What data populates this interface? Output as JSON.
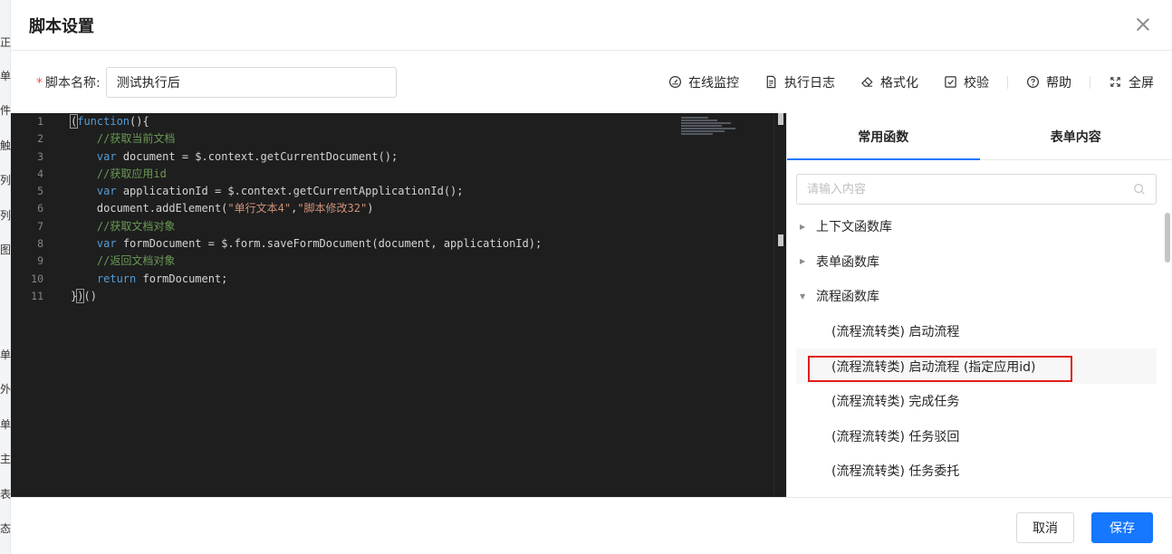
{
  "background_edge": [
    "正",
    "单",
    "件",
    "触",
    "列",
    "列",
    "图",
    "单",
    "外",
    "单",
    "主",
    "表",
    "态"
  ],
  "modal": {
    "title": "脚本设置",
    "close_icon": "close-icon"
  },
  "toolbar": {
    "name_label": "脚本名称:",
    "required_mark": "*",
    "name_value": "测试执行后",
    "actions": [
      {
        "label": "在线监控",
        "icon": "dashboard-icon"
      },
      {
        "label": "执行日志",
        "icon": "file-text-icon"
      },
      {
        "label": "格式化",
        "icon": "eraser-icon"
      },
      {
        "label": "校验",
        "icon": "check-square-icon"
      },
      {
        "label": "帮助",
        "icon": "help-circle-icon"
      },
      {
        "label": "全屏",
        "icon": "fullscreen-icon"
      }
    ]
  },
  "editor": {
    "line_numbers": [
      "1",
      "2",
      "3",
      "4",
      "5",
      "6",
      "7",
      "8",
      "9",
      "10",
      "11"
    ]
  },
  "side": {
    "tabs": [
      "常用函数",
      "表单内容"
    ],
    "active_tab": "常用函数",
    "search_placeholder": "请输入内容",
    "tree": {
      "groups": [
        {
          "label": "上下文函数库",
          "expanded": false
        },
        {
          "label": "表单函数库",
          "expanded": false
        },
        {
          "label": "流程函数库",
          "expanded": true
        }
      ],
      "flow_items": [
        "(流程流转类) 启动流程",
        "(流程流转类) 启动流程 (指定应用id)",
        "(流程流转类) 完成任务",
        "(流程流转类) 任务驳回",
        "(流程流转类) 任务委托"
      ],
      "highlighted_item": "(流程流转类) 启动流程 (指定应用id)"
    }
  },
  "footer": {
    "cancel_label": "取消",
    "save_label": "保存"
  },
  "colors": {
    "primary": "#1677ff",
    "editor_bg": "#1e1e1e",
    "highlight_box": "#e11d1d"
  }
}
